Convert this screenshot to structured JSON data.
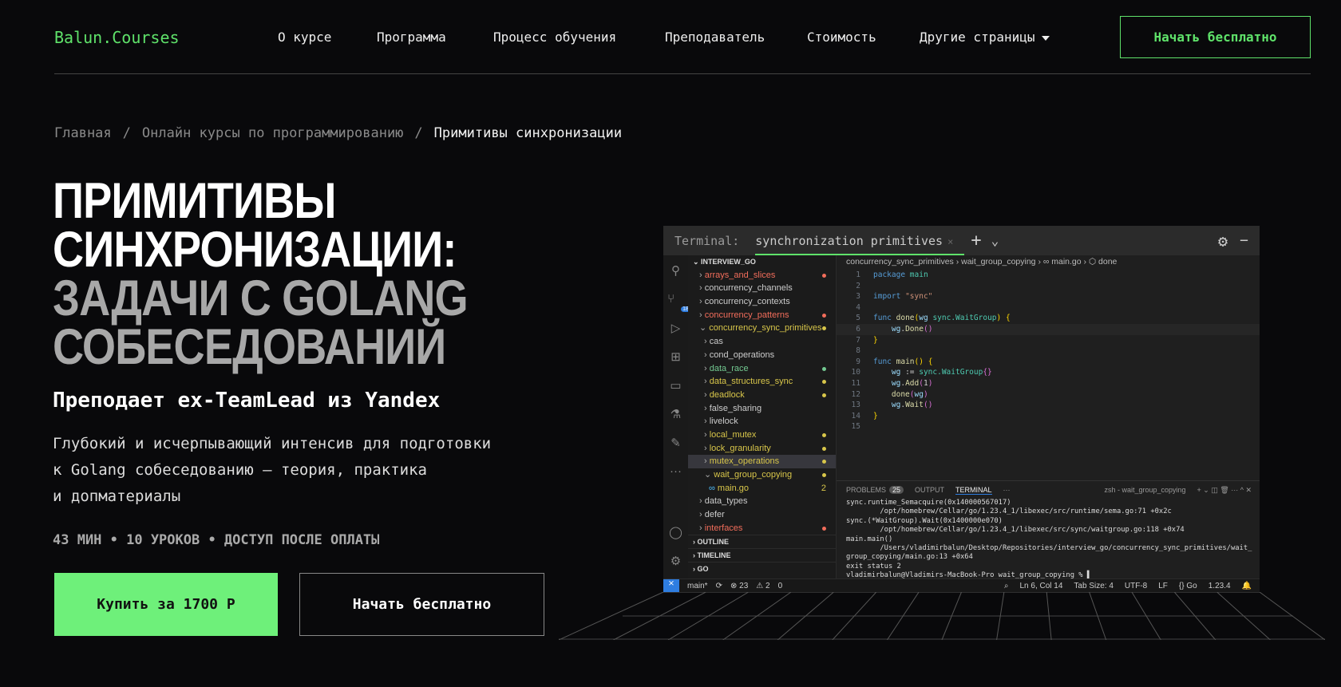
{
  "header": {
    "logo": "Balun.Courses",
    "nav": [
      "О курсе",
      "Программа",
      "Процесс обучения",
      "Преподаватель",
      "Стоимость",
      "Другие страницы"
    ],
    "cta": "Начать бесплатно"
  },
  "breadcrumb": {
    "items": [
      "Главная",
      "Онлайн курсы по программированию",
      "Примитивы синхронизации"
    ],
    "sep": "/"
  },
  "hero": {
    "title_lines": [
      "ПРИМИТИВЫ",
      "СИНХРОНИЗАЦИИ:",
      "ЗАДАЧИ С GOLANG",
      "СОБЕСЕДОВАНИЙ"
    ],
    "subtitle": "Преподает ex-TeamLead из Yandex",
    "desc_lines": [
      "Глубокий и исчерпывающий интенсив для подготовки",
      "к Golang собеседованию — теория, практика",
      "и допматериалы"
    ],
    "meta": "43 МИН • 10 УРОКОВ • ДОСТУП ПОСЛЕ ОПЛАТЫ",
    "buy": "Купить за 1700 Р",
    "free": "Начать бесплатно"
  },
  "colors": {
    "accent": "#5fe26a",
    "button": "#6ef07a",
    "bg": "#09090b"
  },
  "vscode": {
    "top": {
      "label": "Terminal:",
      "tab": "synchronization primitives",
      "close": "×"
    },
    "badge": "18",
    "explorer": {
      "root": "INTERVIEW_GO",
      "items": [
        {
          "label": "arrays_and_slices",
          "color": "#f26d5b",
          "dot": "#f26d5b",
          "depth": 0,
          "open": false
        },
        {
          "label": "concurrency_channels",
          "color": "#ccc",
          "dot": "",
          "depth": 0,
          "open": false
        },
        {
          "label": "concurrency_contexts",
          "color": "#ccc",
          "dot": "",
          "depth": 0,
          "open": false
        },
        {
          "label": "concurrency_patterns",
          "color": "#f26d5b",
          "dot": "#f26d5b",
          "depth": 0,
          "open": false
        },
        {
          "label": "concurrency_sync_primitives",
          "color": "#d8c64a",
          "dot": "#d8c64a",
          "depth": 0,
          "open": true
        },
        {
          "label": "cas",
          "color": "#ccc",
          "dot": "",
          "depth": 1,
          "open": false
        },
        {
          "label": "cond_operations",
          "color": "#ccc",
          "dot": "",
          "depth": 1,
          "open": false
        },
        {
          "label": "data_race",
          "color": "#73c991",
          "dot": "#73c991",
          "depth": 1,
          "open": false
        },
        {
          "label": "data_structures_sync",
          "color": "#d8c64a",
          "dot": "#d8c64a",
          "depth": 1,
          "open": false
        },
        {
          "label": "deadlock",
          "color": "#d8c64a",
          "dot": "#d8c64a",
          "depth": 1,
          "open": false
        },
        {
          "label": "false_sharing",
          "color": "#ccc",
          "dot": "",
          "depth": 1,
          "open": false
        },
        {
          "label": "livelock",
          "color": "#ccc",
          "dot": "",
          "depth": 1,
          "open": false
        },
        {
          "label": "local_mutex",
          "color": "#d8c64a",
          "dot": "#d8c64a",
          "depth": 1,
          "open": false
        },
        {
          "label": "lock_granularity",
          "color": "#d8c64a",
          "dot": "#d8c64a",
          "depth": 1,
          "open": false
        },
        {
          "label": "mutex_operations",
          "color": "#d8c64a",
          "dot": "#d8c64a",
          "depth": 1,
          "open": false
        },
        {
          "label": "wait_group_copying",
          "color": "#d8c64a",
          "dot": "#d8c64a",
          "depth": 1,
          "open": true
        },
        {
          "label": "main.go",
          "color": "#d8c64a",
          "num": "2",
          "depth": 2,
          "open": null
        },
        {
          "label": "data_types",
          "color": "#ccc",
          "dot": "",
          "depth": 0,
          "open": false
        },
        {
          "label": "defer",
          "color": "#ccc",
          "dot": "",
          "depth": 0,
          "open": false
        },
        {
          "label": "interfaces",
          "color": "#f26d5b",
          "dot": "#f26d5b",
          "depth": 0,
          "open": false
        }
      ],
      "sections": [
        "OUTLINE",
        "TIMELINE",
        "GO"
      ]
    },
    "breadcrumb": "concurrency_sync_primitives › wait_group_copying › ∞ main.go › ⬡ done",
    "code": [
      "<span class='kw'>package</span> <span class='ty'>main</span>",
      "",
      "<span class='kw'>import</span> <span class='str'>\"sync\"</span>",
      "",
      "<span class='kw'>func</span> <span class='fn'>done</span><span class='br'>(</span><span class='id'>wg</span> <span class='ty'>sync.WaitGroup</span><span class='br'>)</span> <span class='br'>{</span>",
      "    <span class='id'>wg</span>.<span class='fn'>Done</span><span class='br2'>()</span>",
      "<span class='br'>}</span>",
      "",
      "<span class='kw'>func</span> <span class='fn'>main</span><span class='br'>()</span> <span class='br'>{</span>",
      "    <span class='id'>wg</span> := <span class='ty'>sync.WaitGroup</span><span class='br2'>{}</span>",
      "    <span class='id'>wg</span>.<span class='fn'>Add</span><span class='br2'>(</span>1<span class='br2'>)</span>",
      "    <span class='fn'>done</span><span class='br2'>(</span><span class='id'>wg</span><span class='br2'>)</span>",
      "    <span class='id'>wg</span>.<span class='fn'>Wait</span><span class='br2'>()</span>",
      "<span class='br'>}</span>",
      ""
    ],
    "panel": {
      "tabs": [
        "PROBLEMS",
        "OUTPUT",
        "TERMINAL",
        "···"
      ],
      "problems_count": "25",
      "shell": "zsh - wait_group_copying",
      "lines": [
        "sync.runtime_Semacquire(0x140000567017)",
        "        /opt/homebrew/Cellar/go/1.23.4_1/libexec/src/runtime/sema.go:71 +0x2c",
        "sync.(*WaitGroup).Wait(0x1400000e070)",
        "        /opt/homebrew/Cellar/go/1.23.4_1/libexec/src/sync/waitgroup.go:118 +0x74",
        "main.main()",
        "        /Users/vladimirbalun/Desktop/Repositories/interview_go/concurrency_sync_primitives/wait_",
        "group_copying/main.go:13 +0x64",
        "exit status 2",
        "vladimirbalun@Vladimirs-MacBook-Pro wait_group_copying % ▌"
      ]
    },
    "status": {
      "branch": "main*",
      "errors": "⊗ 23",
      "warnings": "⚠ 2",
      "ports": "0",
      "pos": "Ln 6, Col 14",
      "tab": "Tab Size: 4",
      "enc": "UTF-8",
      "eol": "LF",
      "lang": "{} Go",
      "ver": "1.23.4"
    }
  }
}
